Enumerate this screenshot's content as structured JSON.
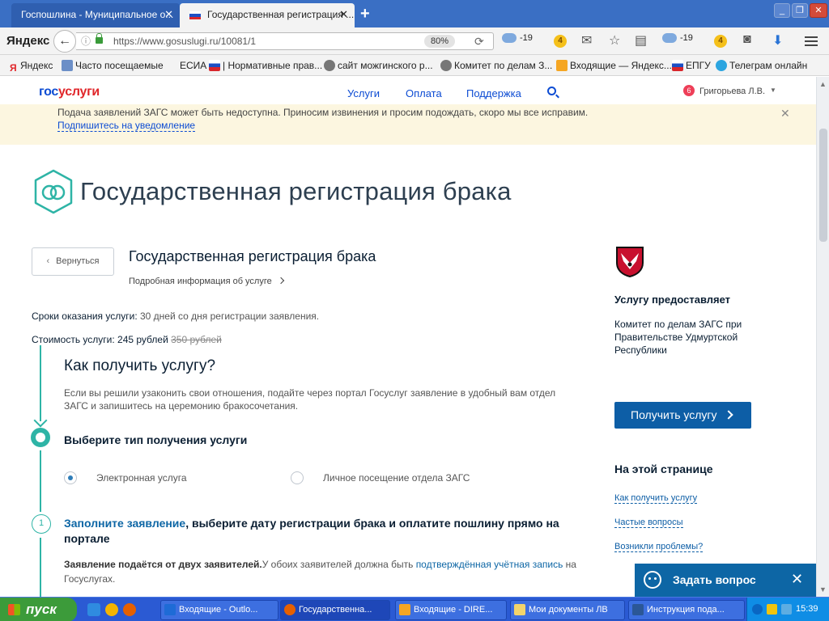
{
  "browser": {
    "tabs": [
      {
        "label": "Госпошлина - Муниципальное о..."
      },
      {
        "label": "Государственная регистрация ..."
      }
    ],
    "url": "https://www.gosuslugi.ru/10081/1",
    "zoom": "80%",
    "yandex_logo": "Яндекс",
    "toolbar": {
      "weather1": "-19",
      "coin1": "4",
      "weather2": "-19",
      "coin2": "4"
    }
  },
  "bookmarks": [
    "Яндекс",
    "Часто посещаемые",
    "ЕСИА",
    "| Нормативные прав...",
    "сайт можгинского р...",
    "Комитет по делам З...",
    "Входящие — Яндекс...",
    "ЕПГУ",
    "Телеграм онлайн"
  ],
  "site": {
    "logo_a": "гос",
    "logo_b": "услуги",
    "nav": [
      "Услуги",
      "Оплата",
      "Поддержка"
    ],
    "notifications_count": "6",
    "user_name": "Григорьева Л.В."
  },
  "notice": {
    "text": "Подача заявлений ЗАГС может быть недоступна. Приносим извинения и просим подождать, скоро мы все исправим.",
    "link": "Подпишитесь на уведомление"
  },
  "page": {
    "hero_title": "Государственная регистрация брака",
    "back_label": "Вернуться",
    "service_title": "Государственная регистрация брака",
    "more_info": "Подробная информация об услуге",
    "term_label": "Сроки оказания услуги:",
    "term_value": " 30 дней со дня регистрации заявления.",
    "cost_label": "Стоимость услуги: 245 рублей",
    "cost_old": "350 рублей",
    "how_title": "Как получить услугу?",
    "how_text": "Если вы решили узаконить свои отношения, подайте через портал Госуслуг заявление в удобный вам отдел ЗАГС и запишитесь на церемонию бракосочетания.",
    "choose_title": "Выберите тип получения услуги",
    "options": [
      "Электронная услуга",
      "Личное посещение отдела ЗАГС"
    ],
    "step1_num": "1",
    "step1_link": "Заполните заявление",
    "step1_rest": ", выберите дату регистрации брака и оплатите пошлину прямо на портале",
    "step1_note_bold": "Заявление подаётся от двух заявителей.",
    "step1_note_a": "У обоих заявителей должна быть ",
    "step1_note_link": "подтверждённая учётная запись",
    "step1_note_b": " на Госуслугах."
  },
  "sidebar": {
    "provider_title": "Услугу предоставляет",
    "provider_text": "Комитет по делам ЗАГС при Правительстве Удмуртской Республики",
    "get_button": "Получить услугу",
    "toc_title": "На этой странице",
    "toc": [
      "Как получить услугу",
      "Частые вопросы",
      "Возникли проблемы?"
    ]
  },
  "ask_widget": {
    "label": "Задать вопрос"
  },
  "taskbar": {
    "start": "пуск",
    "tasks": [
      "Входящие - Outlo...",
      "Государственна...",
      "Входящие - DIRE...",
      "Мои документы ЛВ",
      "Инструкция пода..."
    ],
    "clock": "15:39"
  },
  "colors": {
    "accent": "#0d4cd3",
    "teal": "#2eb4a6",
    "button": "#0d5ea6",
    "notice_bg": "#fcf6e0"
  }
}
